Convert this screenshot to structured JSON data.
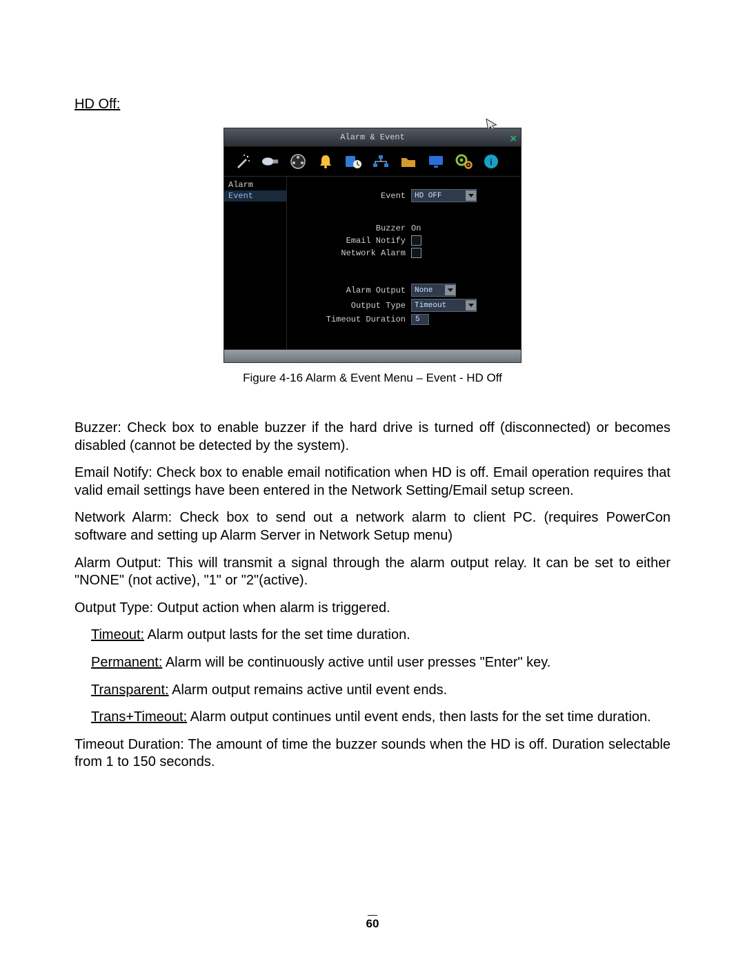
{
  "heading": "HD Off:",
  "dvr": {
    "title": "Alarm & Event",
    "close": "×",
    "sidebar": {
      "items": [
        {
          "label": "Alarm",
          "selected": false
        },
        {
          "label": "Event",
          "selected": true
        }
      ]
    },
    "form": {
      "event_label": "Event",
      "event_value": "HD OFF",
      "buzzer_label": "Buzzer",
      "buzzer_value": "On",
      "email_label": "Email Notify",
      "network_label": "Network Alarm",
      "alarm_out_label": "Alarm Output",
      "alarm_out_value": "None",
      "output_type_label": "Output Type",
      "output_type_value": "Timeout",
      "timeout_dur_label": "Timeout Duration",
      "timeout_dur_value": "5"
    }
  },
  "caption": "Figure 4-16 Alarm & Event Menu – Event - HD Off",
  "paras": {
    "buzzer_term": "Buzzer:",
    "buzzer_rest": " Check box to enable buzzer if the hard drive is turned off (disconnected) or becomes disabled (cannot be detected by the system).",
    "email_term": "Email Notify:",
    "email_rest": " Check box to enable email notification when HD is off.  Email operation requires that valid email settings have been entered in the Network Setting/Email setup screen.",
    "network_term": "Network Alarm:",
    "network_rest": " Check box to send out a network alarm to client PC. (requires PowerCon software and setting up Alarm Server in Network Setup menu)",
    "alarmout_term": "Alarm Output:",
    "alarmout_rest": " This will transmit a signal through the alarm output relay. It can be set to either \"NONE\" (not active), \"1\" or \"2\"(active).",
    "outtype_term": "Output Type:",
    "outtype_rest": " Output action when alarm is triggered.",
    "timeout_u": "Timeout:",
    "timeout_r": " Alarm output lasts for the set time duration.",
    "perm_u": "Permanent:",
    "perm_r": " Alarm will be continuously active until user presses \"Enter\" key.",
    "trans_u": "Transparent:",
    "trans_r": " Alarm output remains active until event ends.",
    "transto_u": "Trans+Timeout:",
    "transto_r": " Alarm output continues until event ends, then lasts for the set time duration.",
    "duration_term": "Timeout Duration:",
    "duration_rest": " The amount of time the buzzer sounds when the HD is off. Duration selectable from 1 to 150 seconds."
  },
  "page_number": "60"
}
